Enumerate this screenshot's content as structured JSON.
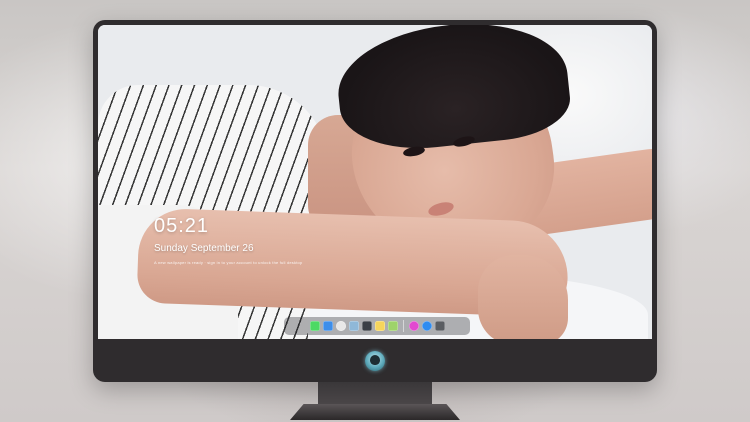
{
  "lockscreen": {
    "time": "05:21",
    "date": "Sunday September 26",
    "note": "A new wallpaper is ready · sign in to your account to unlock the full desktop"
  },
  "dock": {
    "apps": [
      {
        "name": "messages",
        "color": "#4cd964"
      },
      {
        "name": "finder",
        "color": "#3d8eea"
      },
      {
        "name": "safari",
        "color": "#e8e8e8"
      },
      {
        "name": "preview",
        "color": "#8fb8d8"
      },
      {
        "name": "final-cut",
        "color": "#3a3f46"
      },
      {
        "name": "notes",
        "color": "#f6d55c"
      },
      {
        "name": "photos",
        "color": "#9ed36a"
      },
      {
        "name": "itunes",
        "color": "#e24ad0"
      },
      {
        "name": "app-store",
        "color": "#2f8cf0"
      },
      {
        "name": "camera",
        "color": "#5a5d62"
      }
    ]
  },
  "colors": {
    "bezel": "#2f2c2e",
    "logo_glow": "#5ca9ba"
  }
}
